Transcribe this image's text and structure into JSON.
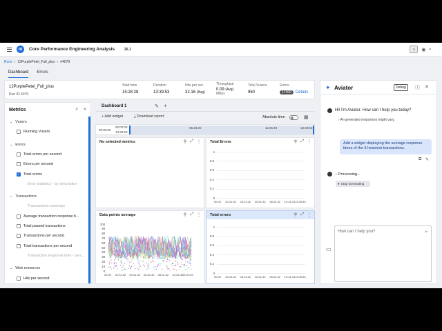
{
  "topbar": {
    "app_title": "Core Performance Engineering Analysis",
    "version": "26.1",
    "logo": "ot"
  },
  "breadcrumb": {
    "root": "Runs",
    "run": "12PurplePetel_Full_plus",
    "id": "#4079"
  },
  "tabs": [
    "Dashboard",
    "Errors"
  ],
  "summary": {
    "run_name": "12PurplePetel_Full_plus",
    "run_id": "Run ID 4079",
    "start_time_label": "Start time",
    "start_time": "15:28:28",
    "duration_label": "Duration",
    "duration": "13:39:53",
    "hits_label": "Hits per sec",
    "hits": "32.16",
    "hits_unit": "(Avg)",
    "throughput_label": "Throughput",
    "throughput": "0.09",
    "throughput_unit": "(Avg)",
    "throughput_sub": "MBps",
    "vusers_label": "Total Vusers",
    "vusers": "960",
    "errors_label": "Errors",
    "errors": "17400",
    "details": "Details"
  },
  "metrics": {
    "title": "Metrics",
    "rows": [
      {
        "t": "group",
        "label": "Vusers"
      },
      {
        "t": "item",
        "label": "Running Vusers",
        "checked": false
      },
      {
        "t": "group",
        "label": "Errors"
      },
      {
        "t": "item",
        "label": "Total errors per second",
        "checked": false
      },
      {
        "t": "item",
        "label": "Errors per second",
        "checked": false
      },
      {
        "t": "item",
        "label": "Total errors",
        "checked": true
      },
      {
        "t": "dis",
        "label": "Error statistics - by description"
      },
      {
        "t": "group",
        "label": "Transactions"
      },
      {
        "t": "dis",
        "label": "Transactions summary"
      },
      {
        "t": "item",
        "label": "Average transaction response ti...",
        "checked": false
      },
      {
        "t": "item",
        "label": "Total passed transactions",
        "checked": false
      },
      {
        "t": "item",
        "label": "Transactions per second",
        "checked": false
      },
      {
        "t": "item",
        "label": "Total transactions per second",
        "checked": false
      },
      {
        "t": "dis",
        "label": "Transaction response time - perc..."
      },
      {
        "t": "group",
        "label": "Web resources"
      },
      {
        "t": "item",
        "label": "Hits per second",
        "checked": false
      },
      {
        "t": "item",
        "label": "Throughput",
        "checked": false
      }
    ]
  },
  "dashboard": {
    "name": "Dashboard 1",
    "add_widget": "Add widget",
    "download": "Download report",
    "absolute_time": "Absolute time",
    "timeline": {
      "start": "00:00:00",
      "sel_start_1": "00:00:00",
      "sel_start_2": "13:39:53",
      "mid1": "05:33:20",
      "mid2": "11:06:40",
      "end": "13:39:53"
    }
  },
  "panels": {
    "p1": {
      "title": "No selected metrics"
    },
    "p2": {
      "title": "Total Errors",
      "yticks": [
        "1",
        "0.8",
        "0.6",
        "0.4",
        "0.2",
        "0"
      ],
      "xticks": [
        "00:00",
        "02:31:32",
        "04:31:32",
        "06:31:32",
        "08:31:32",
        "10:31:32",
        "13:39:53"
      ]
    },
    "p3": {
      "title": "Data points average",
      "yticks": [
        "100",
        "90",
        "80",
        "70",
        "60",
        "50",
        "40",
        "30",
        "20",
        "10",
        "0"
      ],
      "xticks": [
        "00:00",
        "02:31:32",
        "04:31:32",
        "06:31:32",
        "08:31:32",
        "10:31:32",
        "13:39:53"
      ]
    },
    "p4": {
      "title": "Total errors",
      "yticks": [
        "1",
        "0.8",
        "0.6",
        "0.4",
        "0.2",
        "0"
      ],
      "xticks": [
        "00:00",
        "02:31:32",
        "04:31:32",
        "06:31:32",
        "08:31:32",
        "10:31:32",
        "13:39:53"
      ]
    }
  },
  "aviator": {
    "title": "Aviator",
    "debug": "Debug",
    "greeting": "Hi! I'm Aviator. How can I help you today?",
    "ai_disclaimer": "AI-generated responses might vary.",
    "user_msg": "Add a widget displaying the average response times of the 5 heaviest transactions.",
    "processing": "Processing...",
    "stop": "Stop Generating",
    "placeholder": "How can I help you?"
  },
  "colors": {
    "accent": "#1d6fd8",
    "selected_panel": "#dbe7fa",
    "user_bubble": "#d9e5fb"
  }
}
